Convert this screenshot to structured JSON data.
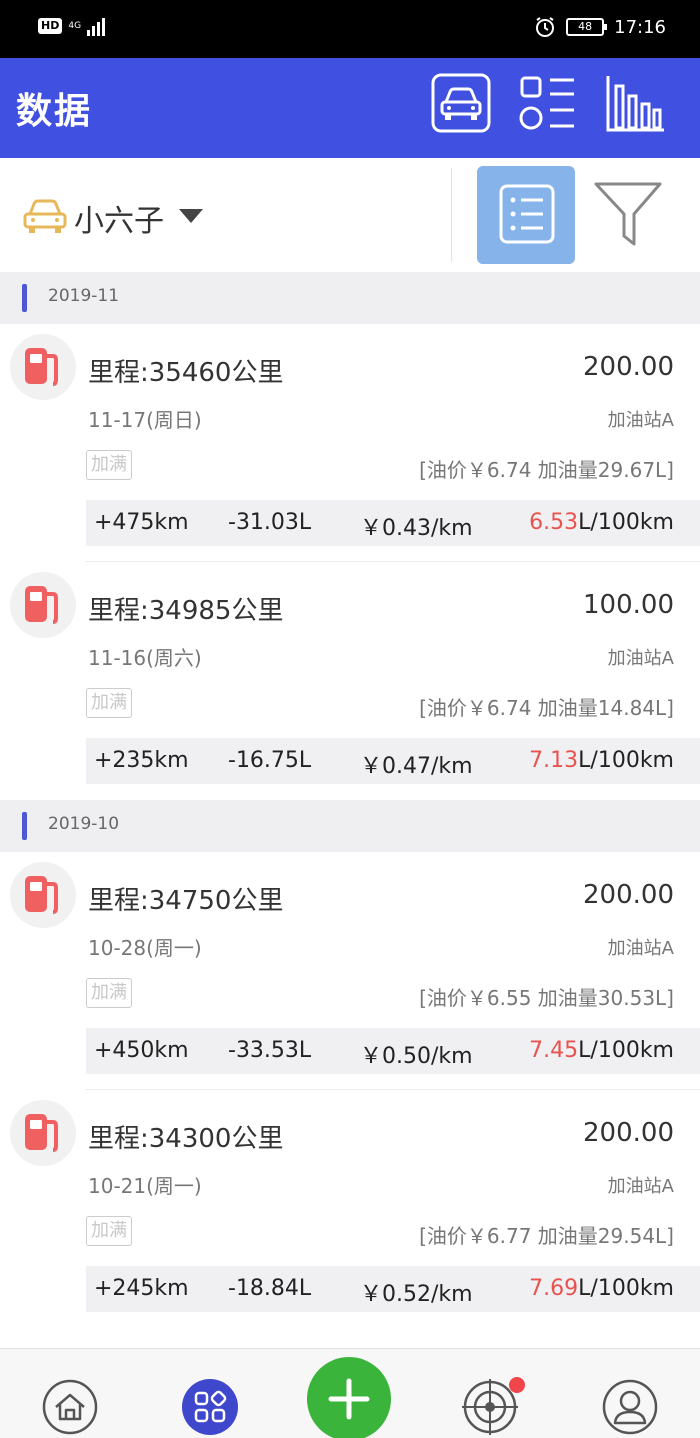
{
  "status_bar": {
    "hd": "HD",
    "network": "4G",
    "time": "17:16",
    "battery": "48"
  },
  "header": {
    "title": "数据",
    "icons": [
      "car-icon",
      "list-menu-icon",
      "bar-chart-icon"
    ]
  },
  "selector": {
    "car_name": "小六子",
    "icons": [
      "car-outline-icon",
      "dropdown-arrow-icon",
      "list-view-icon",
      "filter-icon"
    ]
  },
  "months": [
    {
      "label": "2019-11"
    },
    {
      "label": "2019-10"
    }
  ],
  "entries": [
    {
      "odometer": "里程:35460公里",
      "amount": "200.00",
      "date": "11-17(周日)",
      "station": "加油站A",
      "full_tag": "加满",
      "price": "[油价￥6.74  加油量29.67L]",
      "distance": "+475km",
      "fuel_used": "-31.03L",
      "cost_per_km": "￥0.43/km",
      "consumption": "6.53",
      "consumption_unit": "L/100km"
    },
    {
      "odometer": "里程:34985公里",
      "amount": "100.00",
      "date": "11-16(周六)",
      "station": "加油站A",
      "full_tag": "加满",
      "price": "[油价￥6.74  加油量14.84L]",
      "distance": "+235km",
      "fuel_used": "-16.75L",
      "cost_per_km": "￥0.47/km",
      "consumption": "7.13",
      "consumption_unit": "L/100km"
    },
    {
      "odometer": "里程:34750公里",
      "amount": "200.00",
      "date": "10-28(周一)",
      "station": "加油站A",
      "full_tag": "加满",
      "price": "[油价￥6.55  加油量30.53L]",
      "distance": "+450km",
      "fuel_used": "-33.53L",
      "cost_per_km": "￥0.50/km",
      "consumption": "7.45",
      "consumption_unit": "L/100km"
    },
    {
      "odometer": "里程:34300公里",
      "amount": "200.00",
      "date": "10-21(周一)",
      "station": "加油站A",
      "full_tag": "加满",
      "price": "[油价￥6.77  加油量29.54L]",
      "distance": "+245km",
      "fuel_used": "-18.84L",
      "cost_per_km": "￥0.52/km",
      "consumption": "7.69",
      "consumption_unit": "L/100km"
    }
  ],
  "bottom_nav": {
    "icons": [
      "home-icon",
      "apps-icon",
      "add-icon",
      "radar-icon",
      "profile-icon"
    ],
    "notification_dot": true
  },
  "colors": {
    "primary": "#4050e0",
    "accent_red": "#e8534f",
    "add_green": "#3ab43a",
    "list_btn": "#86b3ea"
  }
}
